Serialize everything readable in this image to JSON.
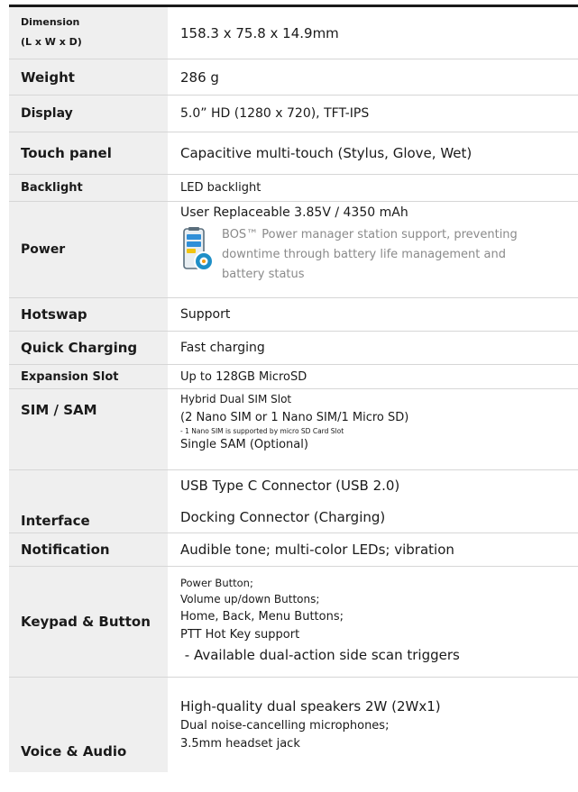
{
  "specs": [
    {
      "label": [
        "Dimension",
        "(L x W x D)"
      ],
      "value": [
        "158.3 x 75.8 x 14.9mm"
      ]
    },
    {
      "label": [
        "Weight"
      ],
      "value": [
        "286 g"
      ]
    },
    {
      "label": [
        "Display"
      ],
      "value": [
        "5.0” HD (1280 x 720), TFT-IPS"
      ]
    },
    {
      "label": [
        "Touch panel"
      ],
      "value": [
        "Capacitive multi-touch (Stylus, Glove, Wet)"
      ]
    },
    {
      "label": [
        "Backlight"
      ],
      "value": [
        "LED backlight"
      ]
    },
    {
      "label": [
        "Power"
      ],
      "value": [
        "User Replaceable 3.85V / 4350 mAh"
      ],
      "note": [
        "BOS™ Power manager station support, preventing",
        "downtime through battery life management and",
        "battery status"
      ]
    },
    {
      "label": [
        "Hotswap"
      ],
      "value": [
        "Support"
      ]
    },
    {
      "label": [
        "Quick Charging"
      ],
      "value": [
        "Fast charging"
      ]
    },
    {
      "label": [
        "Expansion Slot"
      ],
      "value": [
        "Up to 128GB MicroSD"
      ]
    },
    {
      "label": [
        "SIM / SAM"
      ],
      "value": [
        "Hybrid Dual SIM Slot",
        "(2 Nano SIM or 1 Nano SIM/1 Micro SD)",
        "- 1 Nano SIM is supported by micro SD Card Slot",
        "Single SAM (Optional)"
      ]
    },
    {
      "label": [
        "Interface"
      ],
      "value": [
        "USB Type C Connector (USB 2.0)",
        "Docking Connector (Charging)"
      ]
    },
    {
      "label": [
        "Notification"
      ],
      "value": [
        "Audible tone; multi-color LEDs; vibration"
      ]
    },
    {
      "label": [
        "Keypad & Button"
      ],
      "value": [
        "Power Button;",
        "Volume up/down Buttons;",
        "Home, Back, Menu Buttons;",
        "PTT Hot Key support",
        " - Available dual-action side scan triggers"
      ]
    },
    {
      "label": [
        "Voice & Audio"
      ],
      "value": [
        "High-quality dual speakers 2W (2Wx1)",
        "Dual noise-cancelling microphones;",
        "3.5mm headset jack"
      ]
    }
  ]
}
